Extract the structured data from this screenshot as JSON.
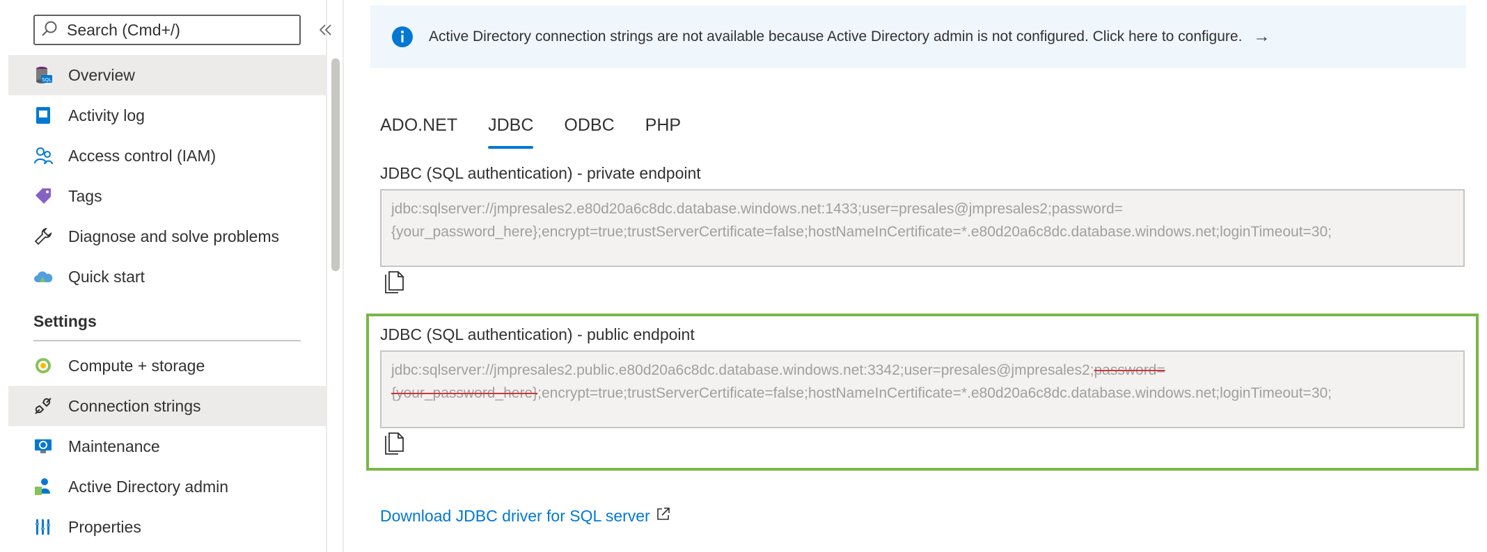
{
  "search": {
    "placeholder": "Search (Cmd+/)"
  },
  "sidebar": {
    "items": [
      {
        "label": "Overview",
        "icon": "sql-database-icon",
        "selected": true
      },
      {
        "label": "Activity log",
        "icon": "activity-log-icon",
        "selected": false
      },
      {
        "label": "Access control (IAM)",
        "icon": "people-icon",
        "selected": false
      },
      {
        "label": "Tags",
        "icon": "tag-icon",
        "selected": false
      },
      {
        "label": "Diagnose and solve problems",
        "icon": "wrench-icon",
        "selected": false
      },
      {
        "label": "Quick start",
        "icon": "cloud-icon",
        "selected": false
      }
    ],
    "settings_heading": "Settings",
    "settings_items": [
      {
        "label": "Compute + storage",
        "icon": "compute-icon",
        "selected": false
      },
      {
        "label": "Connection strings",
        "icon": "plug-icon",
        "selected": true
      },
      {
        "label": "Maintenance",
        "icon": "maintenance-icon",
        "selected": false
      },
      {
        "label": "Active Directory admin",
        "icon": "ad-admin-icon",
        "selected": false
      },
      {
        "label": "Properties",
        "icon": "properties-icon",
        "selected": false
      }
    ]
  },
  "banner": {
    "message": "Active Directory connection strings are not available because Active Directory admin is not configured. Click here to configure.",
    "arrow": "→"
  },
  "tabs": [
    {
      "label": "ADO.NET",
      "active": false
    },
    {
      "label": "JDBC",
      "active": true
    },
    {
      "label": "ODBC",
      "active": false
    },
    {
      "label": "PHP",
      "active": false
    }
  ],
  "private_endpoint": {
    "label": "JDBC (SQL authentication) - private endpoint",
    "value_line1": "jdbc:sqlserver://jmpresales2.e80d20a6c8dc.database.windows.net:1433;user=presales@jmpresales2;password=",
    "value_line2": "{your_password_here};encrypt=true;trustServerCertificate=false;hostNameInCertificate=*.e80d20a6c8dc.database.windows.net;loginTimeout=30;"
  },
  "public_endpoint": {
    "label": "JDBC (SQL authentication) - public endpoint",
    "value_part1": "jdbc:sqlserver://jmpresales2.public.e80d20a6c8dc.database.windows.net:3342;user=presales@jmpresales2;",
    "value_struck1": "password=",
    "value_struck2": "{your_password_here}",
    "value_part2": ";encrypt=true;trustServerCertificate=false;hostNameInCertificate=*.e80d20a6c8dc.database.windows.net;loginTimeout=30;"
  },
  "download": {
    "label": "Download JDBC driver for SQL server"
  },
  "colors": {
    "accent": "#0078d4",
    "highlight": "#7ab648",
    "strike": "#d13438"
  }
}
